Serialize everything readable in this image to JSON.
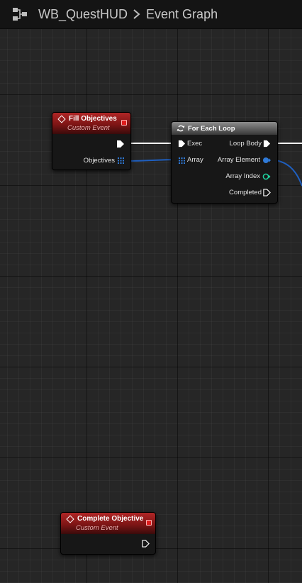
{
  "breadcrumb": {
    "blueprint": "WB_QuestHUD",
    "graph": "Event Graph"
  },
  "nodes": {
    "fill_objectives": {
      "title": "Fill Objectives",
      "subtitle": "Custom Event",
      "output_pin": "Objectives"
    },
    "for_each_loop": {
      "title": "For Each Loop",
      "inputs": [
        "Exec",
        "Array"
      ],
      "outputs": [
        "Loop Body",
        "Array Element",
        "Array Index",
        "Completed"
      ]
    },
    "complete_objective": {
      "title": "Complete Objective",
      "subtitle": "Custom Event"
    }
  },
  "colors": {
    "event_header": "#9b1f1f",
    "loop_header": "#6e6e6e",
    "exec_wire": "#ffffff",
    "array_wire": "#1f5fbf",
    "object_pin": "#2f7ad8",
    "integer_pin": "#1fd3a0"
  },
  "icons": {
    "graph": "blueprint-graph-icon",
    "separator": "chevron-right-icon",
    "event": "event-diamond-icon",
    "loop": "loop-icon",
    "delegate": "delegate-pin-icon"
  }
}
